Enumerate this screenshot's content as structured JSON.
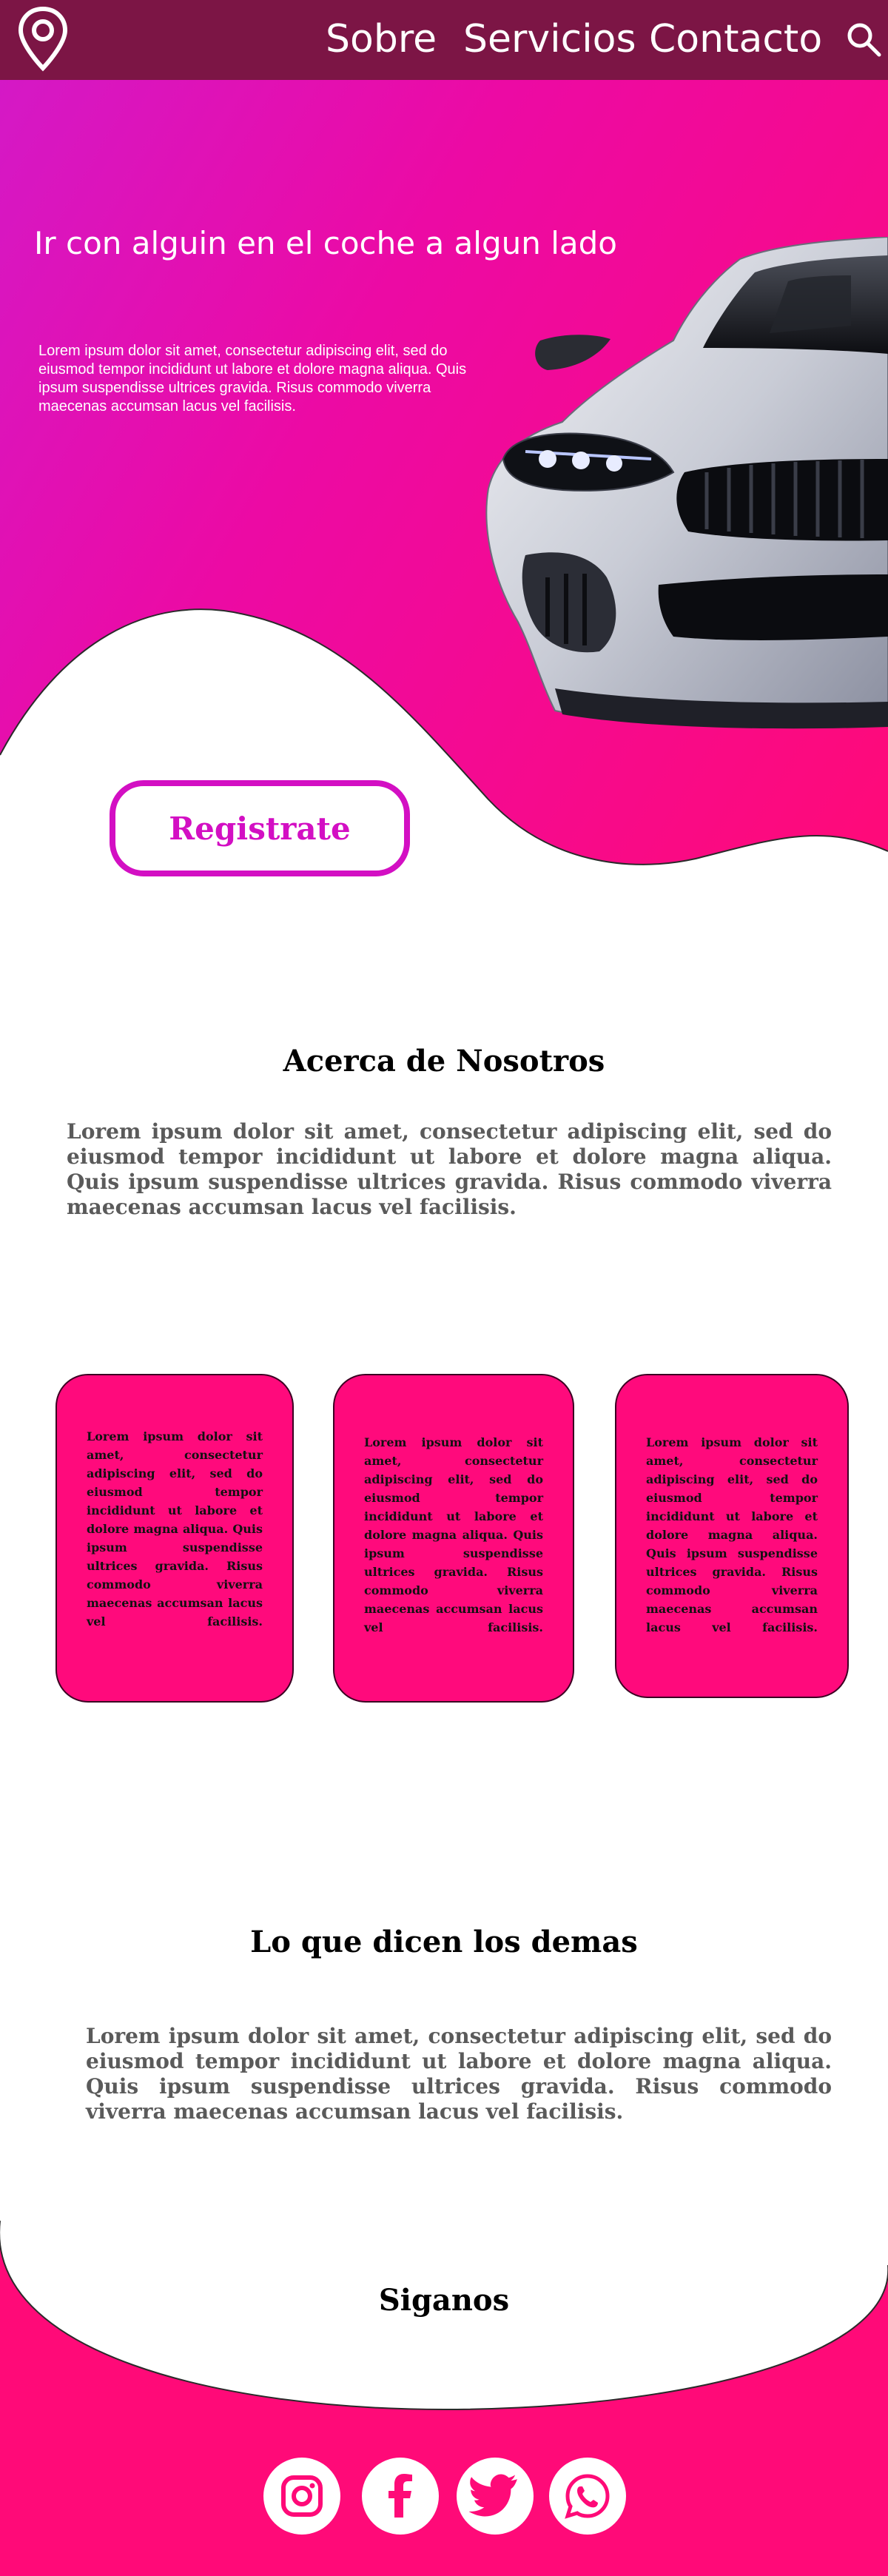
{
  "nav": {
    "links": [
      "Sobre",
      "Servicios",
      "Contacto"
    ]
  },
  "icons": {
    "logo": "map-pin-icon",
    "search": "search-icon",
    "social": [
      "instagram-icon",
      "facebook-icon",
      "twitter-icon",
      "whatsapp-icon"
    ]
  },
  "hero": {
    "title": "Ir con alguin en el coche a algun lado",
    "text": "Lorem ipsum dolor sit amet, consectetur adipiscing elit, sed do eiusmod tempor incididunt ut labore et dolore magna aliqua. Quis ipsum suspendisse ultrices gravida. Risus commodo viverra maecenas accumsan lacus vel facilisis.",
    "button_label": "Registrate"
  },
  "about": {
    "title": "Acerca de Nosotros",
    "text": "Lorem ipsum dolor sit amet, consectetur adipiscing elit, sed do eiusmod tempor incididunt ut labore et dolore magna aliqua. Quis ipsum suspendisse ultrices gravida. Risus commodo viverra maecenas accumsan lacus vel facilisis."
  },
  "cards": [
    {
      "text": "Lorem ipsum dolor sit amet, consectetur adipiscing elit, sed do eiusmod tempor incididunt ut labore et dolore magna aliqua. Quis ipsum suspendisse ultrices gravida. Risus commodo viverra maecenas accumsan lacus vel facilisis."
    },
    {
      "text": "Lorem ipsum dolor sit amet, consectetur adipiscing elit, sed do eiusmod tempor incididunt ut labore et dolore magna aliqua. Quis ipsum suspendisse ultrices gravida. Risus commodo viverra maecenas accumsan lacus vel facilisis."
    },
    {
      "text": "Lorem ipsum dolor sit amet, consectetur adipiscing elit, sed do eiusmod tempor incididunt ut labore et dolore magna aliqua. Quis ipsum suspendisse ultrices gravida. Risus commodo viverra maecenas accumsan lacus vel facilisis."
    }
  ],
  "testimonials": {
    "title": "Lo que dicen los demas",
    "text": "Lorem ipsum dolor sit amet, consectetur adipiscing elit, sed do eiusmod tempor incididunt ut labore et dolore magna aliqua. Quis ipsum suspendisse ultrices gravida. Risus commodo viverra maecenas accumsan lacus vel facilisis."
  },
  "footer": {
    "title": "Siganos"
  },
  "colors": {
    "topbar": "#7c1545",
    "accent_pink": "#ff0a7c",
    "accent_magenta": "#d30fc3",
    "text_gray": "#5a5a5a"
  }
}
